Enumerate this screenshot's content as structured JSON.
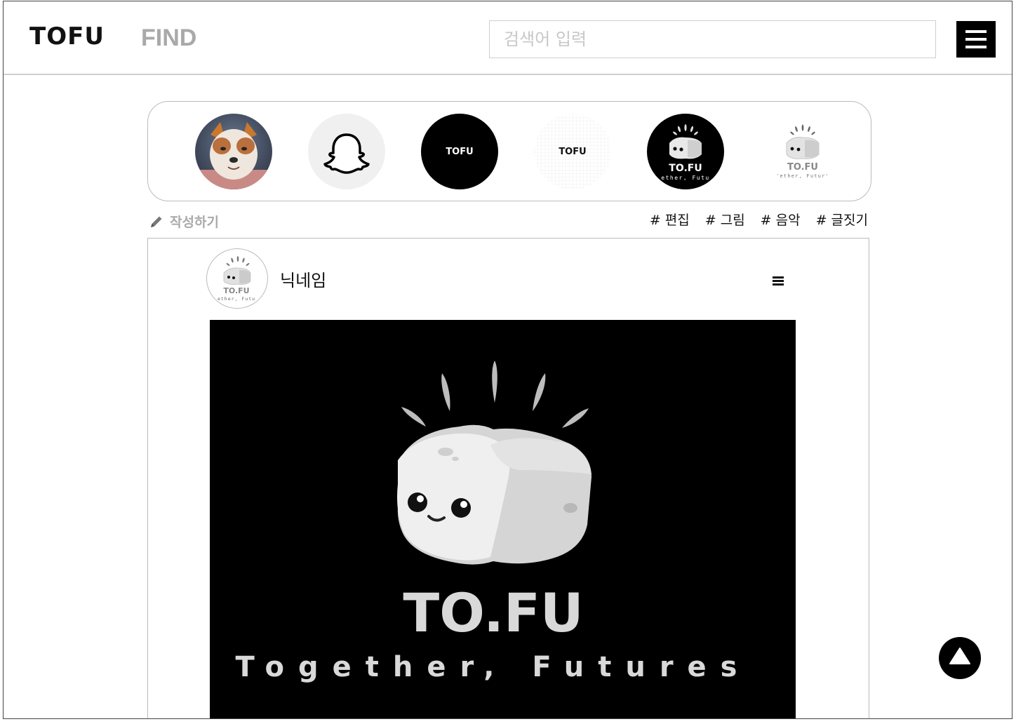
{
  "header": {
    "logo": "TOFU",
    "find_label": "FIND",
    "search_placeholder": "검색어 입력"
  },
  "stories": [
    {
      "name": "dog-photo"
    },
    {
      "name": "ghost"
    },
    {
      "name": "tofu-black",
      "text": "TOFU"
    },
    {
      "name": "tofu-grid",
      "text": "TOFU"
    },
    {
      "name": "tofu-mascot-dark",
      "text": "TO.FU",
      "subtext": "ether, Futu"
    },
    {
      "name": "tofu-mascot-light",
      "text": "TO.FU",
      "subtext": "'ether, Futur'"
    }
  ],
  "toolbar": {
    "write_label": "작성하기",
    "tags": [
      "# 편집",
      "# 그림",
      "# 음악",
      "# 글짓기"
    ]
  },
  "post": {
    "nickname": "닉네임",
    "avatar": {
      "text": "TO.FU",
      "subtext": "ether, Futu"
    },
    "image": {
      "title": "TO.FU",
      "subtitle": "Together, Futures"
    }
  },
  "colors": {
    "accent": "#000000",
    "muted_text": "#a9a9a9",
    "border": "#bbbbbb"
  },
  "icons": {
    "menu": "hamburger-icon",
    "write": "pencil-icon",
    "scroll_top": "triangle-up-icon"
  }
}
